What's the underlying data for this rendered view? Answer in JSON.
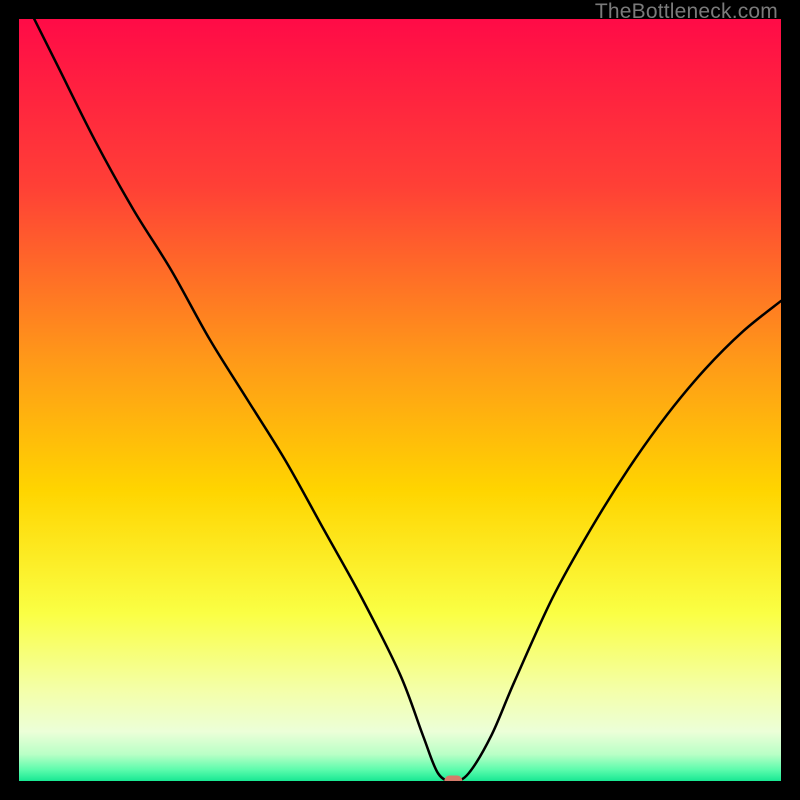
{
  "watermark": "TheBottleneck.com",
  "chart_data": {
    "type": "line",
    "title": "",
    "xlabel": "",
    "ylabel": "",
    "xlim": [
      0,
      100
    ],
    "ylim": [
      0,
      100
    ],
    "grid": false,
    "legend": false,
    "series": [
      {
        "name": "bottleneck-curve",
        "x": [
          2,
          5,
          10,
          15,
          20,
          25,
          30,
          35,
          40,
          45,
          50,
          53,
          55,
          57,
          59,
          62,
          65,
          70,
          75,
          80,
          85,
          90,
          95,
          100
        ],
        "y": [
          100,
          94,
          84,
          75,
          67,
          58,
          50,
          42,
          33,
          24,
          14,
          6,
          1,
          0,
          1,
          6,
          13,
          24,
          33,
          41,
          48,
          54,
          59,
          63
        ]
      }
    ],
    "marker": {
      "x": 57,
      "y": 0,
      "color": "#d47a6a"
    },
    "gradient_stops": [
      {
        "offset": 0,
        "color": "#ff0b47"
      },
      {
        "offset": 0.22,
        "color": "#ff4036"
      },
      {
        "offset": 0.45,
        "color": "#ff9a18"
      },
      {
        "offset": 0.62,
        "color": "#ffd500"
      },
      {
        "offset": 0.78,
        "color": "#faff44"
      },
      {
        "offset": 0.88,
        "color": "#f4ffa8"
      },
      {
        "offset": 0.935,
        "color": "#ecffd8"
      },
      {
        "offset": 0.965,
        "color": "#b9ffc6"
      },
      {
        "offset": 0.985,
        "color": "#5dfcad"
      },
      {
        "offset": 1.0,
        "color": "#18e893"
      }
    ]
  }
}
